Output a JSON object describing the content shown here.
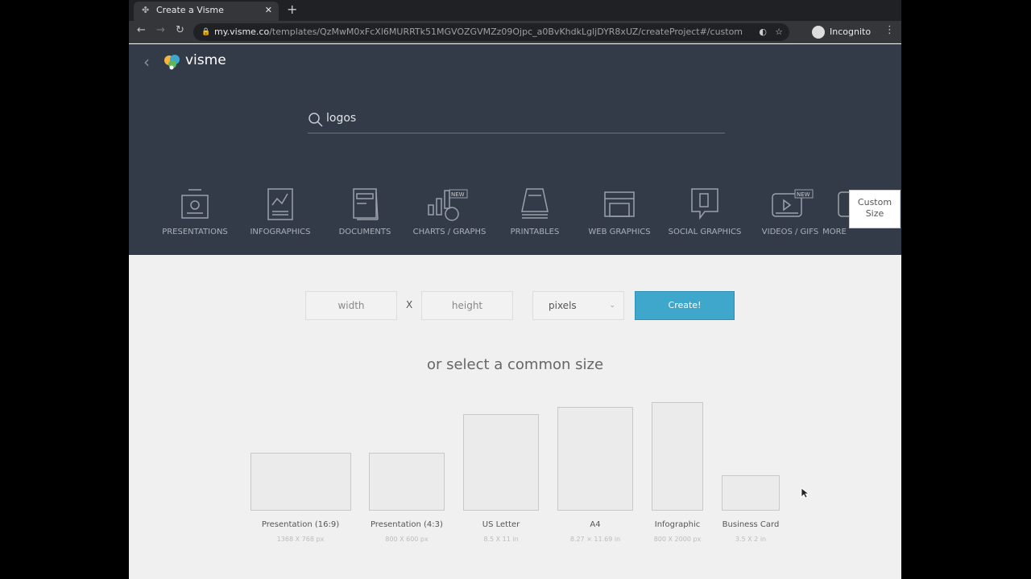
{
  "browser": {
    "tab_title": "Create a Visme",
    "url_host": "my.visme.co",
    "url_path": "/templates/QzMwM0xFcXl6MURRTk51MGVOZGVMZz09Ojpc_a0BvKhdkLgljDYR8xUZ/createProject#/custom",
    "profile": "Incognito"
  },
  "header": {
    "logo": "visme",
    "search_value": "logos"
  },
  "categories": [
    {
      "label": "PRESENTATIONS",
      "badge": ""
    },
    {
      "label": "INFOGRAPHICS",
      "badge": ""
    },
    {
      "label": "DOCUMENTS",
      "badge": ""
    },
    {
      "label": "CHARTS / GRAPHS",
      "badge": "NEW"
    },
    {
      "label": "PRINTABLES",
      "badge": ""
    },
    {
      "label": "WEB GRAPHICS",
      "badge": ""
    },
    {
      "label": "SOCIAL GRAPHICS",
      "badge": ""
    },
    {
      "label": "VIDEOS / GIFS",
      "badge": "NEW"
    },
    {
      "label": "MORE",
      "badge": ""
    }
  ],
  "tooltip": {
    "line1": "Custom",
    "line2": "Size"
  },
  "custom": {
    "width_placeholder": "width",
    "separator": "X",
    "height_placeholder": "height",
    "unit": "pixels",
    "create_label": "Create!"
  },
  "common_title": "or select a common size",
  "sizes": [
    {
      "name": "Presentation (16:9)",
      "dims": "1368 X 768 px"
    },
    {
      "name": "Presentation (4:3)",
      "dims": "800 X 600 px"
    },
    {
      "name": "US Letter",
      "dims": "8.5 X 11 in"
    },
    {
      "name": "A4",
      "dims": "8.27 × 11.69 in"
    },
    {
      "name": "Infographic",
      "dims": "800 X 2000 px"
    },
    {
      "name": "Business Card",
      "dims": "3.5 X 2 in"
    }
  ],
  "colors": {
    "header_bg": "#333b48",
    "accent": "#3fa7cc"
  }
}
